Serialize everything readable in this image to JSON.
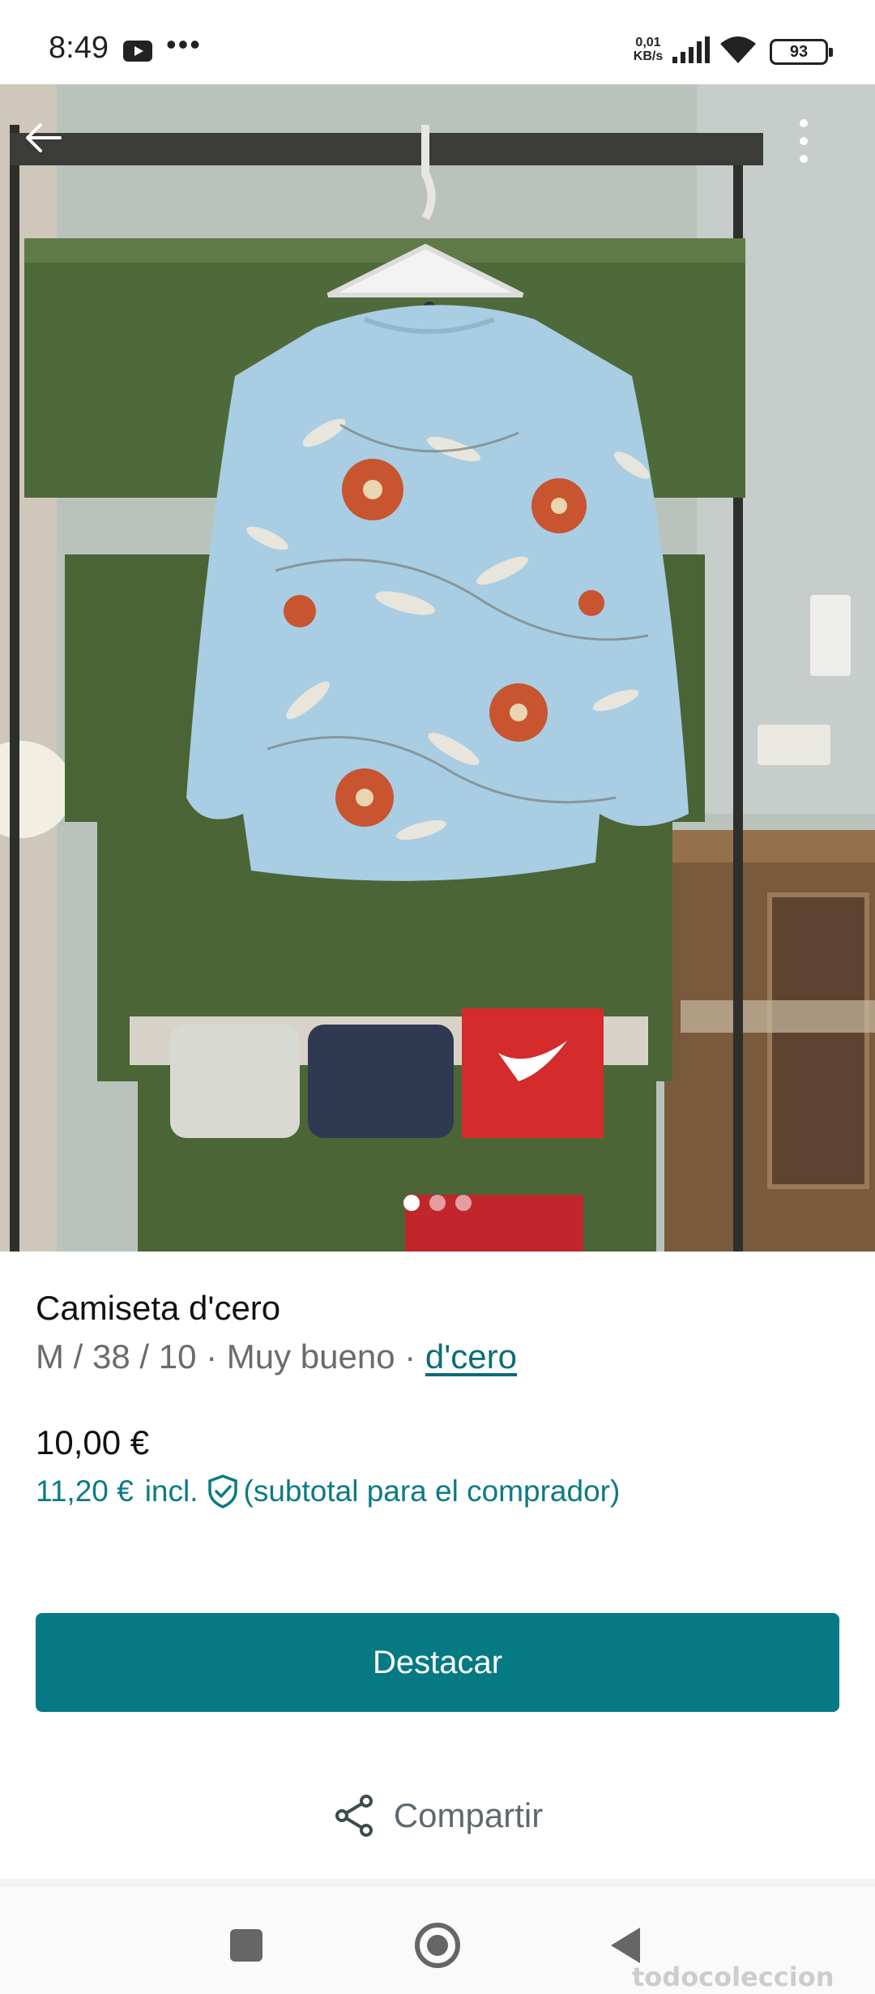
{
  "status_bar": {
    "time": "8:49",
    "dots": "•••",
    "net_speed_value": "0,01",
    "net_speed_unit": "KB/s",
    "battery": "93",
    "icons": [
      "youtube-icon",
      "signal-icon",
      "wifi-icon",
      "battery-icon"
    ]
  },
  "gallery": {
    "image_count": 3,
    "active_index": 0
  },
  "product": {
    "title": "Camiseta d'cero",
    "size": "M / 38 / 10",
    "separator": " · ",
    "condition": "Muy bueno",
    "brand": "d'cero",
    "price": "10,00 €",
    "buyer_price": "11,20 €",
    "buyer_incl": "incl.",
    "buyer_note": "(subtotal para el comprador)"
  },
  "actions": {
    "feature_label": "Destacar",
    "share_label": "Compartir"
  },
  "watermark": "todocoleccion",
  "colors": {
    "accent": "#057a84",
    "link": "#0b6e75",
    "muted_text": "#6b6b6b"
  }
}
